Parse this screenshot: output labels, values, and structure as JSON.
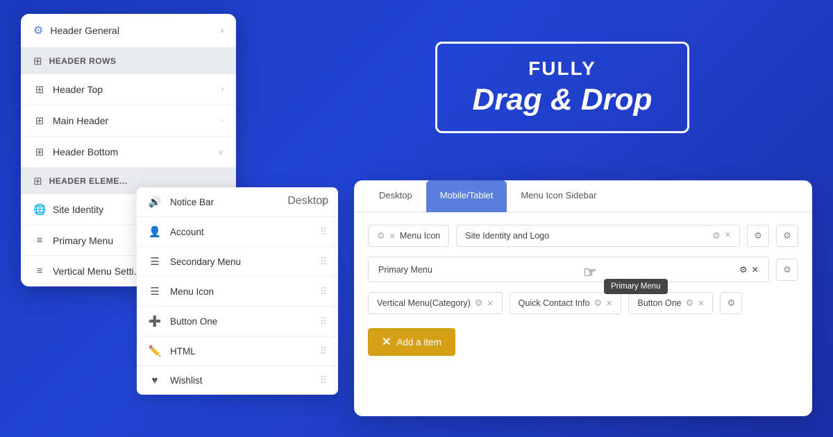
{
  "background": {
    "gradient_start": "#1a3bbf",
    "gradient_end": "#1a2fa8"
  },
  "banner": {
    "fully": "FULLY",
    "drag_drop": "Drag & Drop"
  },
  "sidebar": {
    "header_general_label": "Header General",
    "header_rows_label": "HEADER ROWS",
    "header_top_label": "Header Top",
    "main_header_label": "Main Header",
    "header_bottom_label": "Header Bottom",
    "header_elements_label": "HEADER ELEMENTS",
    "site_identity_label": "Site Identity",
    "primary_menu_label": "Primary Menu",
    "vertical_menu_label": "Vertical Menu Setti..."
  },
  "dropdown": {
    "close_symbol": "✕",
    "items": [
      {
        "id": "notice-bar",
        "icon": "🔊",
        "label": "Notice Bar"
      },
      {
        "id": "account",
        "icon": "👤",
        "label": "Account"
      },
      {
        "id": "secondary-menu",
        "icon": "☰",
        "label": "Secondary Menu"
      },
      {
        "id": "menu-icon",
        "icon": "☰",
        "label": "Menu Icon"
      },
      {
        "id": "button-one",
        "icon": "➕",
        "label": "Button One"
      },
      {
        "id": "html",
        "icon": "✏️",
        "label": "HTML"
      },
      {
        "id": "wishlist",
        "icon": "♥",
        "label": "Wishlist"
      }
    ]
  },
  "main_panel": {
    "tabs": [
      {
        "id": "desktop",
        "label": "Desktop"
      },
      {
        "id": "mobile-tablet",
        "label": "Mobile/Tablet"
      },
      {
        "id": "menu-icon-sidebar",
        "label": "Menu Icon Sidebar"
      }
    ],
    "active_tab": "mobile-tablet",
    "row1": {
      "col1": {
        "label": "Menu Icon"
      },
      "col2": {
        "label": "Site Identity and Logo"
      }
    },
    "row2": {
      "col1": {
        "label": "Primary Menu"
      }
    },
    "row3": {
      "col1": {
        "label": "Vertical Menu(Category)"
      },
      "col2": {
        "label": "Quick Contact Info"
      },
      "col3": {
        "label": "Button One"
      }
    },
    "tooltip": "Primary Menu",
    "add_item_label": "Add a item",
    "add_item_icon": "✕"
  }
}
